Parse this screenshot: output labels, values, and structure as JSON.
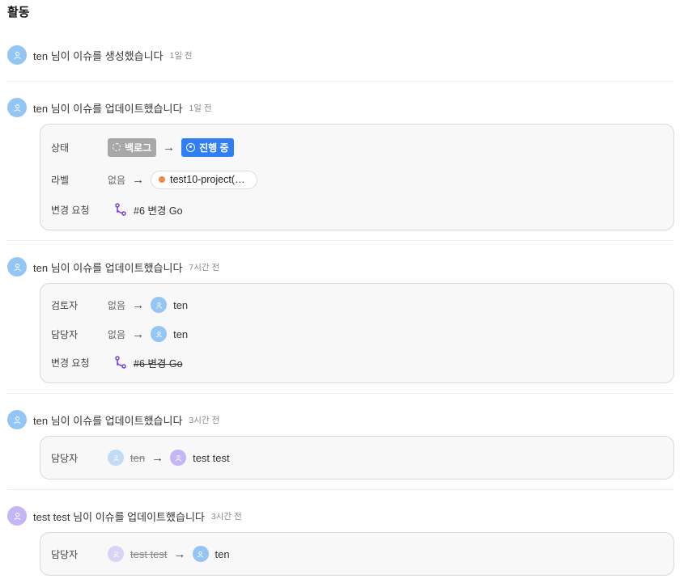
{
  "section_title": "활동",
  "arrow": "→",
  "entries": [
    {
      "actor": "ten",
      "action": "님이 이슈를 생성했습니다",
      "time": "1일 전"
    },
    {
      "actor": "ten",
      "action": "님이 이슈를 업데이트했습니다",
      "time": "1일 전",
      "changes": {
        "status_label": "상태",
        "status_from": "백로그",
        "status_to": "진행 중",
        "label_label": "라벨",
        "label_from": "없음",
        "label_to": "test10-project(oran…",
        "mr_label": "변경 요청",
        "mr_value": "#6 변경 Go"
      }
    },
    {
      "actor": "ten",
      "action": "님이 이슈를 업데이트했습니다",
      "time": "7시간 전",
      "changes": {
        "reviewer_label": "검토자",
        "reviewer_from": "없음",
        "reviewer_to": "ten",
        "assignee_label": "담당자",
        "assignee_from": "없음",
        "assignee_to": "ten",
        "mr_label": "변경 요청",
        "mr_value": "#6 변경 Go"
      }
    },
    {
      "actor": "ten",
      "action": "님이 이슈를 업데이트했습니다",
      "time": "3시간 전",
      "changes": {
        "assignee_label": "담당자",
        "assignee_from": "ten",
        "assignee_to": "test test"
      }
    },
    {
      "actor": "test test",
      "action": "님이 이슈를 업데이트했습니다",
      "time": "3시간 전",
      "changes": {
        "assignee_label": "담당자",
        "assignee_from": "test test",
        "assignee_to": "ten"
      }
    }
  ],
  "colors": {
    "avatar_ten": "#93c5f5",
    "avatar_test": "#c4b5f6",
    "status_backlog": "#a7a7a7",
    "status_in_progress": "#2f7ef5",
    "label_dot": "#f08a4b",
    "mr_icon": "#7b3fe4"
  },
  "icons": {
    "avatar": "user-icon",
    "merge_request": "merge-request-icon",
    "backlog": "dashed-circle-icon",
    "in_progress": "target-circle-icon"
  }
}
